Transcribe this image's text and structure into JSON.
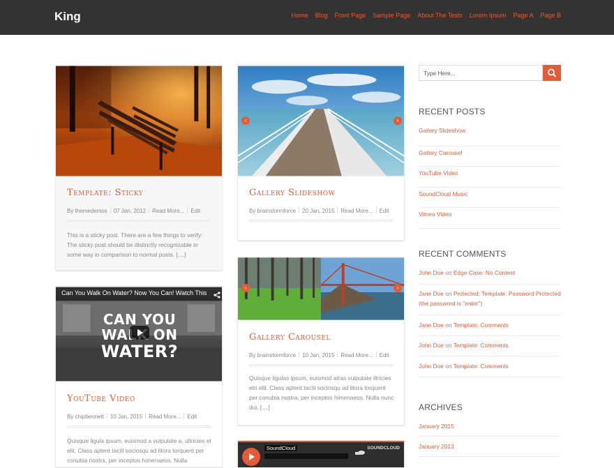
{
  "site": {
    "title": "King"
  },
  "nav": [
    "Home",
    "Blog",
    "Front Page",
    "Sample Page",
    "About The Tests",
    "Lorem Ipsum",
    "Page A",
    "Page B"
  ],
  "posts": {
    "sticky": {
      "title": "Template: Sticky",
      "author": "By themedemos",
      "date": "07 Jan, 2012",
      "read_more": "Read More...",
      "edit": "Edit",
      "excerpt": "This is a sticky post. There are a few things to verify: The sticky post should be distinctly recognizable in some way in comparison to normal posts. [....]"
    },
    "youtube": {
      "video_caption": "Can You Walk On Water? Now You Can! Watch This",
      "overlay_line1": "CAN YOU",
      "overlay_line2": "WALK ON",
      "overlay_line3": "WATER?",
      "title": "YouTube Video",
      "author": "By chipbennett",
      "date": "10 Jan, 2015",
      "read_more": "Read More...",
      "edit": "Edit",
      "excerpt": "Quisque ligula ipsum, euismod a vulputate a, ultricies et elit. Class aptent taciti sociosqu ad litora torquent per conubia nostra, per inceptos himenaeos. Nulla"
    },
    "slideshow": {
      "title": "Gallery Slideshow",
      "author": "By brainstormforce",
      "date": "20 Jan, 2015",
      "read_more": "Read More...",
      "edit": "Edit"
    },
    "carousel": {
      "title": "Gallery Carousel",
      "author": "By brainstormforce",
      "date": "10 Jan, 2015",
      "read_more": "Read More...",
      "edit": "Edit",
      "excerpt": "Quisque ligulas ipsum, euismod atras vulputate iltricies etri elit. Class aptent taciti sociosqu ad litora torquent per conubia nostra, per inceptos himenaeos. Nulla nunc dui, [....]"
    },
    "soundcloud": {
      "label": "SoundCloud",
      "brand": "SOUNDCLOUD"
    }
  },
  "sidebar": {
    "search_placeholder": "Type Here...",
    "recent_posts_title": "RECENT POSTS",
    "recent_posts": [
      "Gallery Slideshow",
      "Gallery Carousel",
      "YouTube Video",
      "SoundCloud Music",
      "Vimeo Video"
    ],
    "recent_comments_title": "RECENT COMMENTS",
    "recent_comments": [
      {
        "author": "John Doe",
        "on": "on",
        "post": "Edge Case: No Content"
      },
      {
        "author": "Jane Doe",
        "on": "on",
        "post": "Protected: Template: Password Protected (the password is \"enter\")"
      },
      {
        "author": "Jane Doe",
        "on": "on",
        "post": "Template: Comments"
      },
      {
        "author": "John Doe",
        "on": "on",
        "post": "Template: Comments"
      },
      {
        "author": "John Doe",
        "on": "on",
        "post": "Template: Comments"
      }
    ],
    "archives_title": "ARCHIVES",
    "archives": [
      "January 2015",
      "January 2013"
    ]
  },
  "colors": {
    "accent": "#e25c3a",
    "header_bg": "#333333"
  }
}
